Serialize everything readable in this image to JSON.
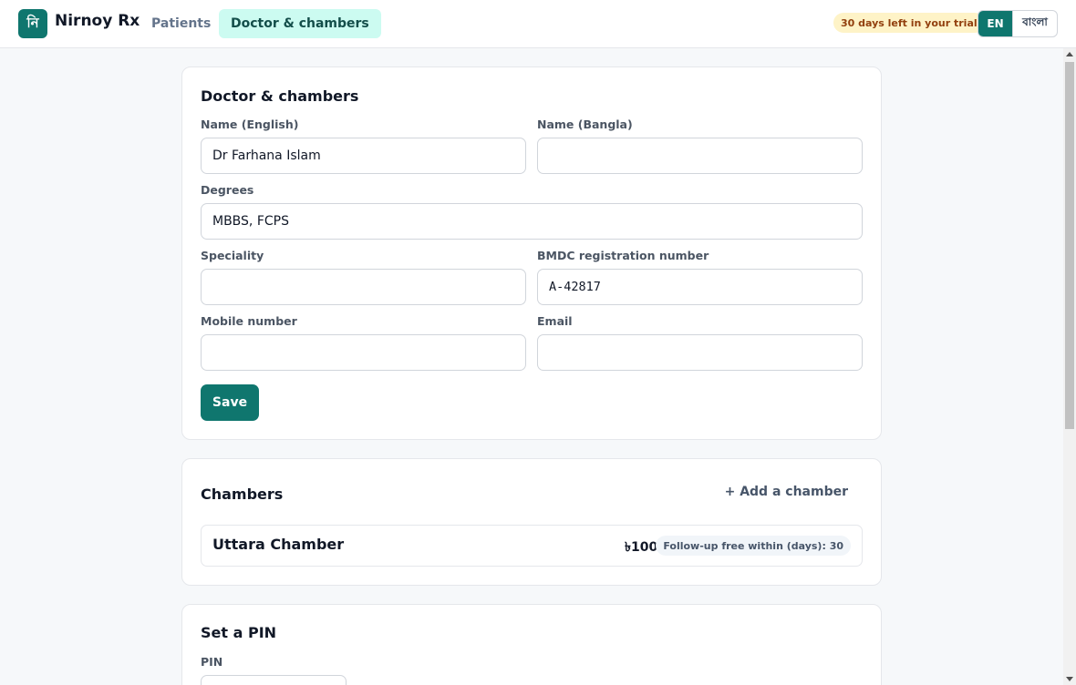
{
  "header": {
    "logo_glyph": "নি",
    "brand": "Nirnoy Rx",
    "tabs": [
      {
        "label": "Patients"
      },
      {
        "label": "Doctor & chambers"
      }
    ],
    "trial_badge": "30 days left in your trial",
    "lang": {
      "en": "EN",
      "bn": "বাংলা",
      "active": "EN"
    }
  },
  "doctor_card": {
    "title": "Doctor & chambers",
    "fields": {
      "name_en": {
        "label": "Name (English)",
        "value": "Dr Farhana Islam"
      },
      "name_bn": {
        "label": "Name (Bangla)",
        "value": ""
      },
      "degrees": {
        "label": "Degrees",
        "value": "MBBS, FCPS"
      },
      "speciality": {
        "label": "Speciality",
        "value": ""
      },
      "bmdc": {
        "label": "BMDC registration number",
        "value": "A-42817"
      },
      "mobile": {
        "label": "Mobile number",
        "value": ""
      },
      "email": {
        "label": "Email",
        "value": ""
      }
    },
    "save_label": "Save"
  },
  "chambers_card": {
    "title": "Chambers",
    "add_label": "+ Add a chamber",
    "items": [
      {
        "name": "Uttara Chamber",
        "fee": "৳1000",
        "followup": "Follow-up free within (days): 30"
      }
    ]
  },
  "pin_card": {
    "title": "Set a PIN",
    "pin_label": "PIN",
    "pin_value": ""
  },
  "colors": {
    "accent": "#0f766e",
    "accent_soft": "#ccfbf1",
    "trial_bg": "#fef3c7",
    "trial_text": "#92400e"
  }
}
